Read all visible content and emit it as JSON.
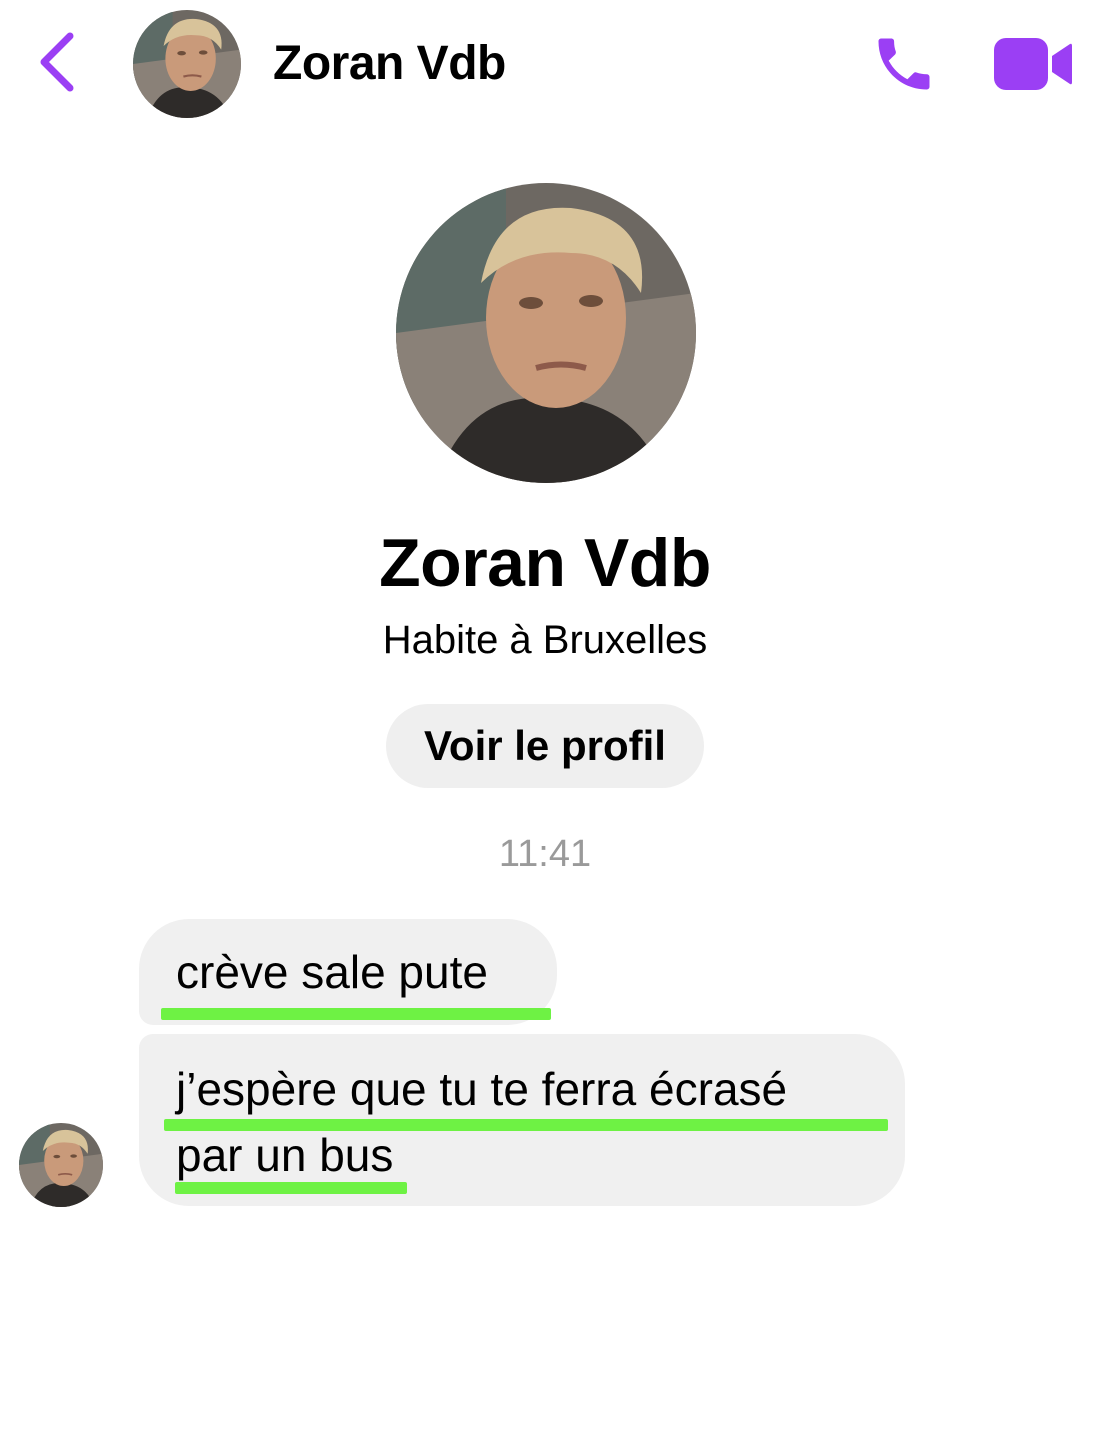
{
  "colors": {
    "accent": "#9b3ff4",
    "bubble_bg": "#f0f0f0",
    "button_bg": "#efefef",
    "timestamp": "#9a9a9a",
    "highlight": "#6ef244"
  },
  "header": {
    "name": "Zoran Vdb",
    "icons": [
      "chevron-left-icon",
      "phone-icon",
      "video-camera-icon"
    ]
  },
  "profile": {
    "name": "Zoran Vdb",
    "location": "Habite à Bruxelles",
    "view_profile_label": "Voir le profil"
  },
  "conversation": {
    "timestamp": "11:41",
    "messages": [
      {
        "lines": [
          "crève sale pute"
        ]
      },
      {
        "lines": [
          "j’espère que tu te ferra écrasé",
          "par un bus"
        ]
      }
    ]
  }
}
